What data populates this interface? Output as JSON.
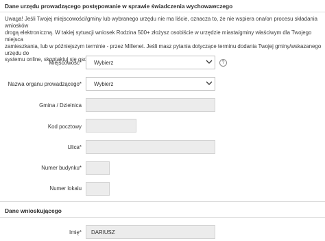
{
  "section1": {
    "title": "Dane urzędu prowadzącego postępowanie w sprawie świadczenia wychowawczego",
    "notice": [
      "Uwaga! Jeśli Twojej miejscowości/gminy lub wybranego urzędu nie ma liście, oznacza to, że nie wspiera ona/on procesu składania wniosków",
      "drogą elektroniczną. W takiej sytuacji wniosek Rodzina 500+ złożysz osobiście w urzędzie miasta/gminy właściwym dla Twojego miejsca",
      "zamieszkania, lub w późniejszym terminie - przez Millenet. Jeśli masz pytania dotyczące terminu dodania Twojej gminy/wskazanego urzędu do",
      "systemu online, skontaktuj się osobiście lub telefonicznie z urzędem miasta/gminy."
    ]
  },
  "fields": {
    "miejscowosc": {
      "label": "Miejscowość",
      "required": "*",
      "value": "Wybierz"
    },
    "organ": {
      "label": "Nazwa organu prowadzącego",
      "required": "*",
      "value": "Wybierz"
    },
    "gmina": {
      "label": "Gmina / Dzielnica",
      "value": ""
    },
    "kod": {
      "label": "Kod pocztowy",
      "value": ""
    },
    "ulica": {
      "label": "Ulica",
      "required": "*",
      "value": ""
    },
    "nr_budynku": {
      "label": "Numer budynku",
      "required": "*",
      "value": ""
    },
    "nr_lokalu": {
      "label": "Numer lokalu",
      "value": ""
    }
  },
  "help_icon": {
    "glyph": "?"
  },
  "section2": {
    "title": "Dane wnioskującego",
    "imie": {
      "label": "Imię",
      "required": "*",
      "value": "DARIUSZ"
    }
  },
  "icons": [
    "chevron-down-icon",
    "help-icon"
  ]
}
